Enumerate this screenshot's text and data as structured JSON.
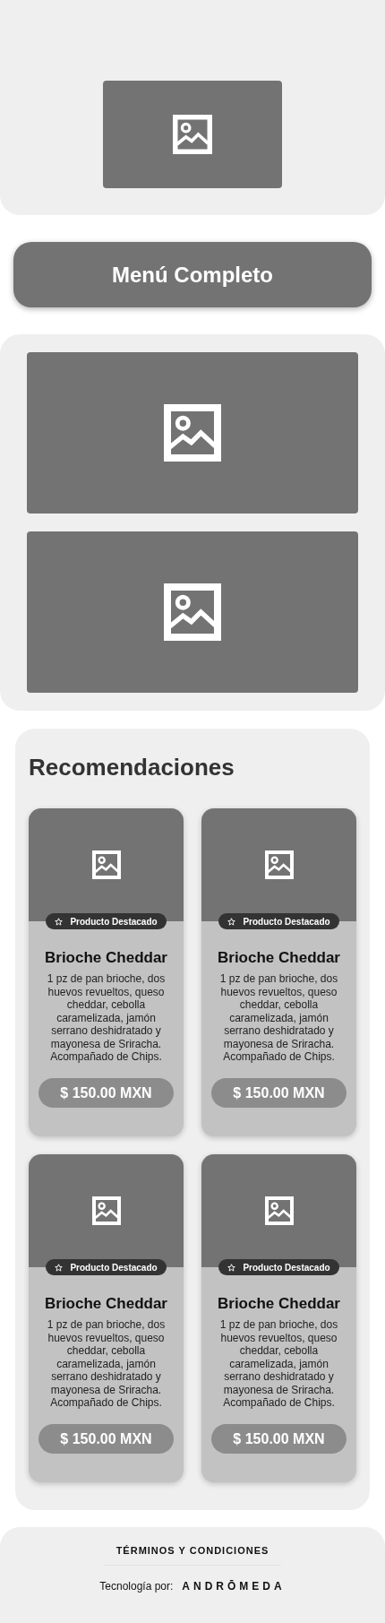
{
  "hero": {
    "image": {
      "kind": "placeholder"
    }
  },
  "menu_button": {
    "label": "Menú Completo"
  },
  "banners": [
    {
      "kind": "placeholder"
    },
    {
      "kind": "placeholder"
    }
  ],
  "recommendations": {
    "title": "Recomendaciones",
    "products": [
      {
        "badge": "Producto Destacado",
        "name": "Brioche Cheddar",
        "description": "1 pz de pan brioche, dos huevos revueltos, queso cheddar, cebolla caramelizada, jamón serrano deshidratado y mayonesa de Sriracha. Acompañado de Chips.",
        "price": "$ 150.00 MXN"
      },
      {
        "badge": "Producto Destacado",
        "name": "Brioche Cheddar",
        "description": "1 pz de pan brioche, dos huevos revueltos, queso cheddar, cebolla caramelizada, jamón serrano deshidratado y mayonesa de Sriracha. Acompañado de Chips.",
        "price": "$ 150.00 MXN"
      },
      {
        "badge": "Producto Destacado",
        "name": "Brioche Cheddar",
        "description": "1 pz de pan brioche, dos huevos revueltos, queso cheddar, cebolla caramelizada, jamón serrano deshidratado y mayonesa de Sriracha. Acompañado de Chips.",
        "price": "$ 150.00 MXN"
      },
      {
        "badge": "Producto Destacado",
        "name": "Brioche Cheddar",
        "description": "1 pz de pan brioche, dos huevos revueltos, queso cheddar, cebolla caramelizada, jamón serrano deshidratado y mayonesa de Sriracha. Acompañado de Chips.",
        "price": "$ 150.00 MXN"
      }
    ]
  },
  "footer": {
    "terms_link": "TÉRMINOS Y CONDICIONES",
    "credit_label": "Tecnología por:",
    "brand": "ANDRŌMEDA"
  }
}
